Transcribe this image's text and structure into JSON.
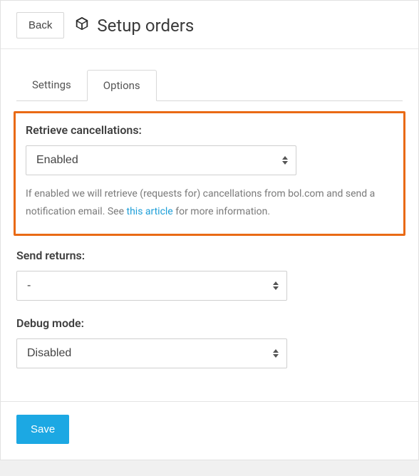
{
  "header": {
    "back_label": "Back",
    "title": "Setup orders"
  },
  "tabs": {
    "settings_label": "Settings",
    "options_label": "Options",
    "active": "Options"
  },
  "fields": {
    "retrieve_cancellations": {
      "label": "Retrieve cancellations:",
      "value": "Enabled",
      "help_before": "If enabled we will retrieve (requests for) cancellations from bol.com and send a notification email. See ",
      "help_link": "this article",
      "help_after": " for more information."
    },
    "send_returns": {
      "label": "Send returns:",
      "value": "-"
    },
    "debug_mode": {
      "label": "Debug mode:",
      "value": "Disabled"
    }
  },
  "footer": {
    "save_label": "Save"
  }
}
